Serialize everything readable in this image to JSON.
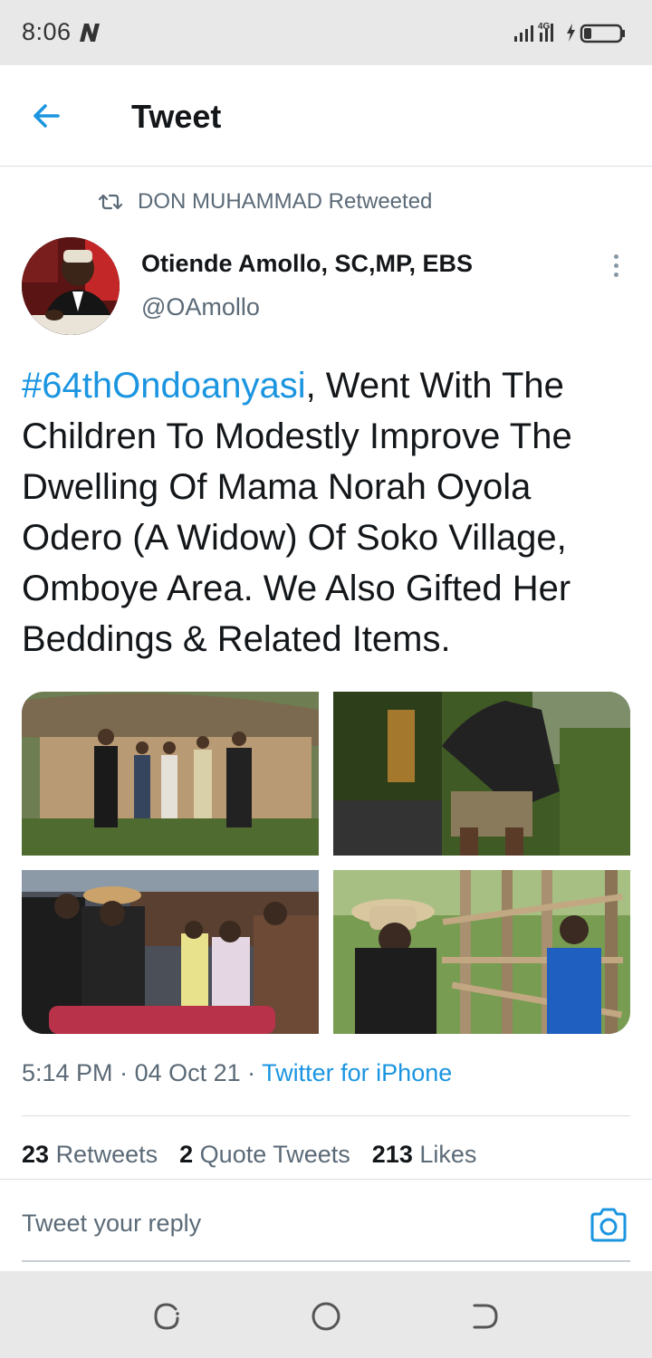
{
  "status_bar": {
    "time": "8:06",
    "network": "4G"
  },
  "header": {
    "title": "Tweet"
  },
  "retweet": {
    "text": "DON MUHAMMAD Retweeted"
  },
  "author": {
    "name": "Otiende Amollo, SC,MP, EBS",
    "handle": "@OAmollo"
  },
  "tweet": {
    "hashtag": "#64thOndoanyasi",
    "body": ", Went With The Children To Modestly Improve The Dwelling Of Mama Norah Oyola Odero (A Widow) Of Soko Village, Omboye Area. We Also Gifted Her Beddings & Related Items."
  },
  "meta": {
    "time": "5:14 PM",
    "sep1": " · ",
    "date": "04 Oct 21",
    "sep2": " · ",
    "source": "Twitter for iPhone"
  },
  "stats": {
    "retweets_count": "23",
    "retweets_label": "Retweets",
    "quotes_count": "2",
    "quotes_label": "Quote Tweets",
    "likes_count": "213",
    "likes_label": "Likes"
  },
  "reply": {
    "placeholder": "Tweet your reply"
  },
  "icons": {
    "back": "arrow-left-icon",
    "retweet": "retweet-icon",
    "more": "more-vertical-icon",
    "camera": "camera-icon"
  },
  "colors": {
    "accent": "#1b95e0",
    "text": "#14171a",
    "muted": "#5b6a77",
    "system_bar": "#e8e8e8"
  }
}
